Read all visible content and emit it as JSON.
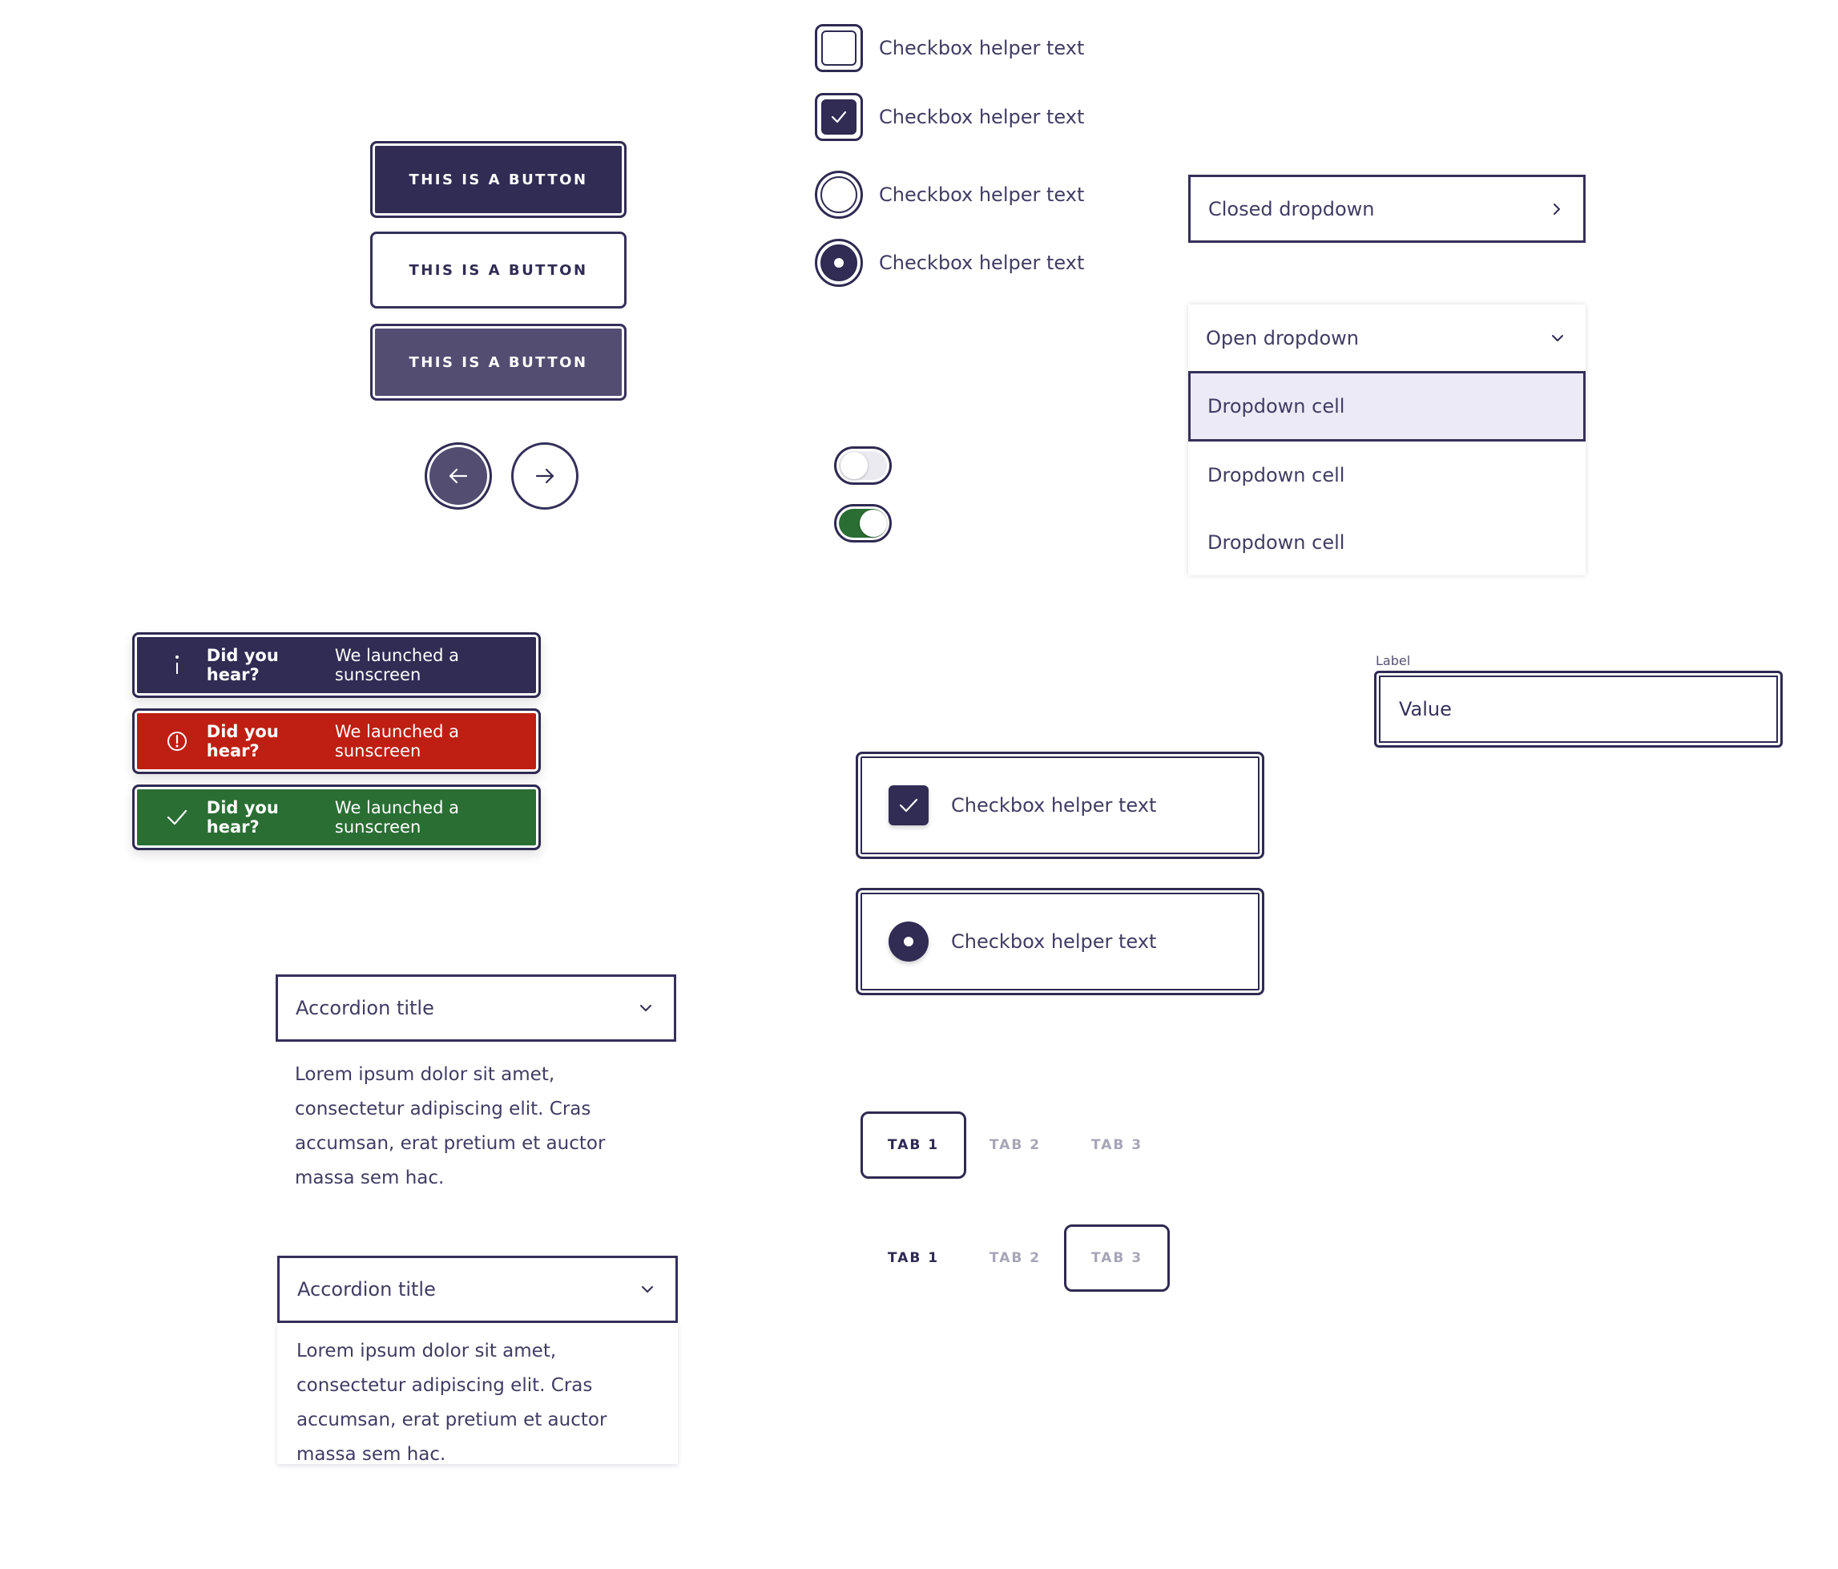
{
  "buttons": {
    "primary_label": "THIS IS A BUTTON",
    "secondary_label": "THIS IS A BUTTON",
    "tertiary_label": "THIS IS A BUTTON",
    "prev_icon": "arrow-left-icon",
    "next_icon": "arrow-right-icon"
  },
  "checkboxes": [
    {
      "type": "checkbox",
      "checked": false,
      "label": "Checkbox helper text"
    },
    {
      "type": "checkbox",
      "checked": true,
      "label": "Checkbox helper text"
    },
    {
      "type": "radio",
      "checked": false,
      "label": "Checkbox helper text"
    },
    {
      "type": "radio",
      "checked": true,
      "label": "Checkbox helper text"
    }
  ],
  "toggles": [
    {
      "on": false
    },
    {
      "on": true
    }
  ],
  "dropdowns": {
    "closed_label": "Closed dropdown",
    "open_label": "Open dropdown",
    "cells": [
      "Dropdown cell",
      "Dropdown cell",
      "Dropdown cell"
    ]
  },
  "alerts": [
    {
      "variant": "info",
      "icon": "info-icon",
      "bold": "Did you hear?",
      "text": "We launched a sunscreen"
    },
    {
      "variant": "error",
      "icon": "alert-circle-icon",
      "bold": "Did you hear?",
      "text": "We launched a sunscreen"
    },
    {
      "variant": "success",
      "icon": "check-icon",
      "bold": "Did you hear?",
      "text": "We launched a sunscreen"
    }
  ],
  "input": {
    "label": "Label",
    "value": "Value"
  },
  "cards": [
    {
      "type": "checkbox",
      "label": "Checkbox helper text"
    },
    {
      "type": "radio",
      "label": "Checkbox helper text"
    }
  ],
  "accordions": [
    {
      "title": "Accordion title",
      "body": "Lorem ipsum dolor sit amet, consectetur adipiscing elit. Cras accumsan, erat pretium et auctor massa sem hac."
    },
    {
      "title": "Accordion title",
      "body": "Lorem ipsum dolor sit amet, consectetur adipiscing elit. Cras accumsan, erat pretium et auctor massa sem hac."
    }
  ],
  "tabs_row1": [
    "TAB 1",
    "TAB 2",
    "TAB 3"
  ],
  "tabs_row2": [
    "TAB 1",
    "TAB 2",
    "TAB 3"
  ],
  "colors": {
    "primary": "#302c54",
    "tertiary": "#524d71",
    "error": "#be1f12",
    "success": "#2a6e34",
    "dropdown_active": "#eceaf6",
    "muted": "#a7a6b7"
  }
}
